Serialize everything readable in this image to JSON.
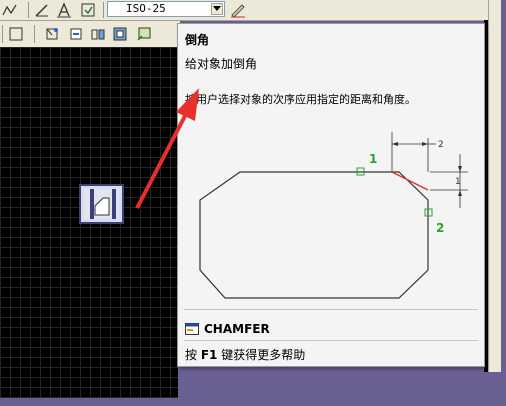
{
  "toolbar": {
    "dimstyle_value": "ISO-25",
    "icons_row1": [
      "linear-dimension-icon",
      "dimension-edit-icon",
      "dimension-text-edit-icon",
      "dimension-update-icon",
      "dimstyle-icon"
    ],
    "icons_row2": [
      "block-icon",
      "insert-icon",
      "region-icon",
      "wipeout-icon",
      "cloud-icon"
    ]
  },
  "tooltip": {
    "title": "倒角",
    "subtitle": "给对象加倒角",
    "description": "按用户选择对象的次序应用指定的距离和角度。",
    "diagram": {
      "label_first": "1",
      "label_second": "2",
      "dist_label_top": "2",
      "dist_label_side": "1"
    },
    "command_name": "CHAMFER",
    "help_prefix": "按",
    "help_key": "F1",
    "help_suffix": "键获得更多帮助"
  },
  "colors": {
    "arrow": "#e8302a",
    "marker_green": "#2aa22a",
    "chamfer_red": "#e03030",
    "frame": "#6a5f93"
  }
}
